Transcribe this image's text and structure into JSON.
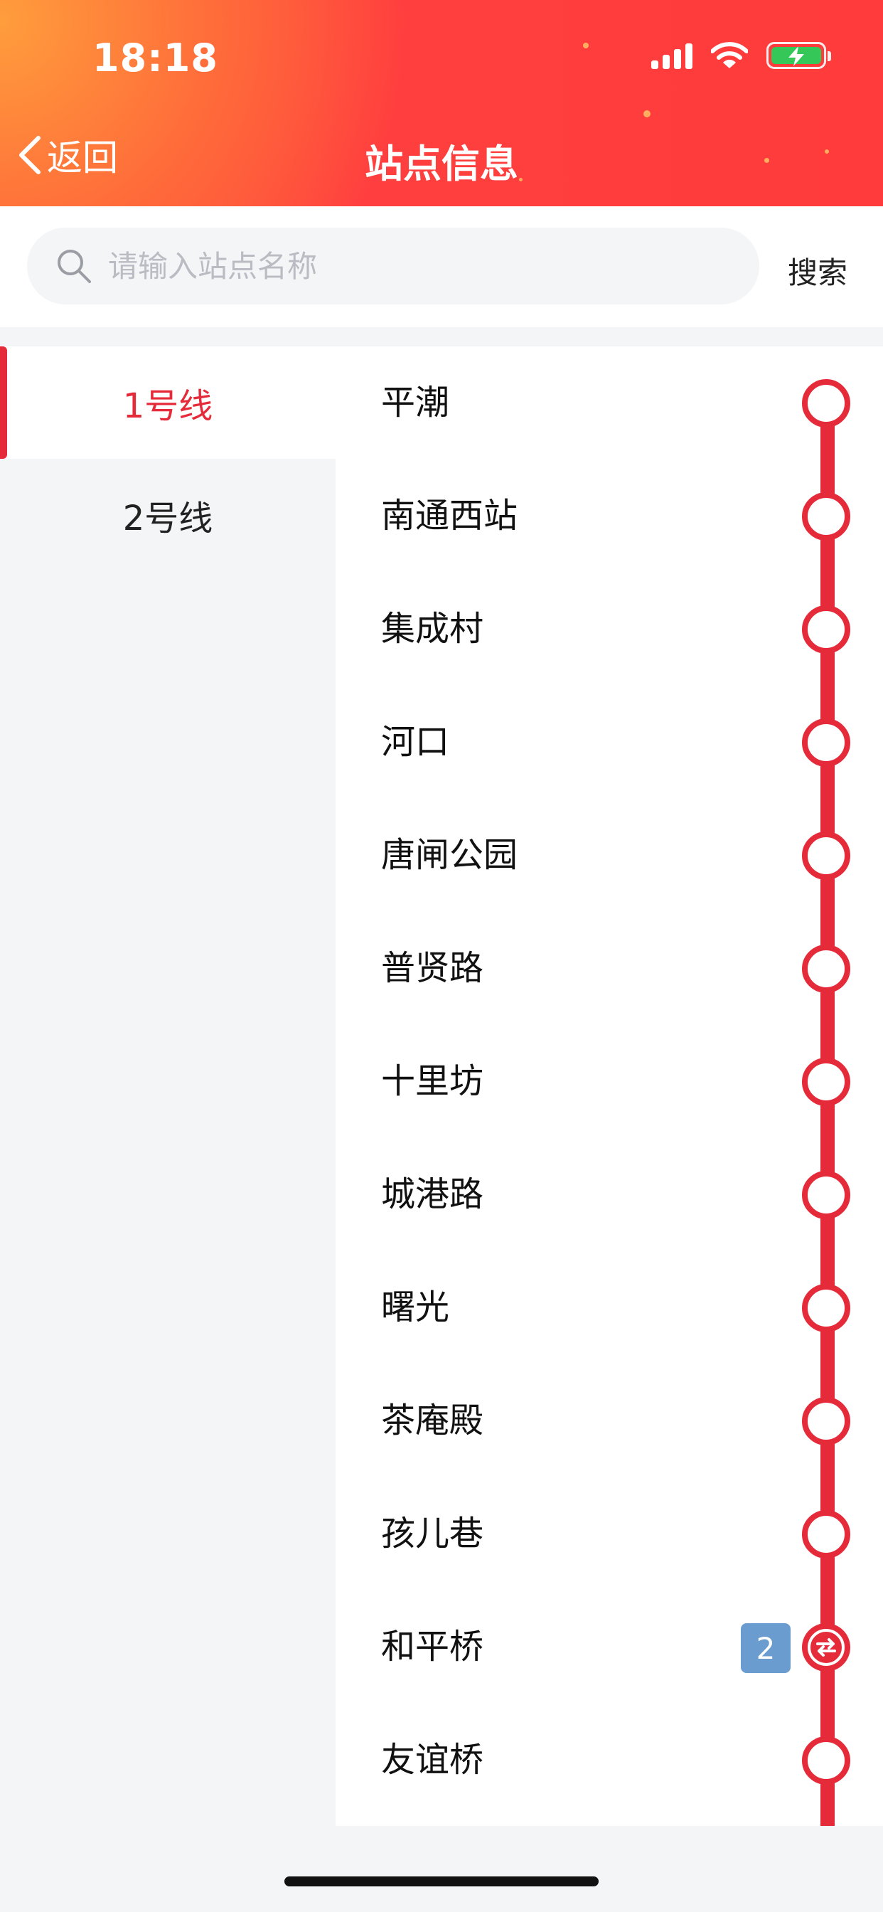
{
  "status_bar": {
    "time": "18:18"
  },
  "header": {
    "back_label": "返回",
    "title": "站点信息"
  },
  "search": {
    "placeholder": "请输入站点名称",
    "button_label": "搜索"
  },
  "lines": [
    {
      "label": "1号线",
      "active": true
    },
    {
      "label": "2号线",
      "active": false
    }
  ],
  "stations": [
    {
      "name": "平潮"
    },
    {
      "name": "南通西站"
    },
    {
      "name": "集成村"
    },
    {
      "name": "河口"
    },
    {
      "name": "唐闸公园"
    },
    {
      "name": "普贤路"
    },
    {
      "name": "十里坊"
    },
    {
      "name": "城港路"
    },
    {
      "name": "曙光"
    },
    {
      "name": "茶庵殿"
    },
    {
      "name": "孩儿巷"
    },
    {
      "name": "和平桥",
      "transfer": "2"
    },
    {
      "name": "友谊桥"
    }
  ],
  "colors": {
    "accent": "#e52b3a",
    "transfer_badge": "#6b9ccf",
    "header_start": "#ff9d3c",
    "header_end": "#ff3b3b"
  }
}
